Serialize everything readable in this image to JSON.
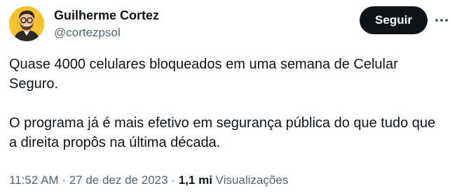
{
  "author": {
    "name": "Guilherme Cortez",
    "handle": "@cortezpsol",
    "avatar_icon": "avatar-illustration",
    "avatar_bg": "#f6c12d"
  },
  "actions": {
    "follow_label": "Seguir",
    "more_icon": "more-options-icon"
  },
  "tweet": {
    "paragraphs": [
      "Quase 4000 celulares bloqueados em uma semana de Celular Seguro.",
      "O programa já é mais efetivo em segurança pública do que tudo que a direita propôs na última década."
    ]
  },
  "meta": {
    "time": "11:52 AM",
    "separator": "·",
    "date": "27 de dez de 2023",
    "views_count": "1,1 mi",
    "views_label": "Visualizações"
  },
  "colors": {
    "text_primary": "#0f1419",
    "text_secondary": "#536471",
    "button_bg": "#0f1419",
    "button_text": "#ffffff"
  }
}
